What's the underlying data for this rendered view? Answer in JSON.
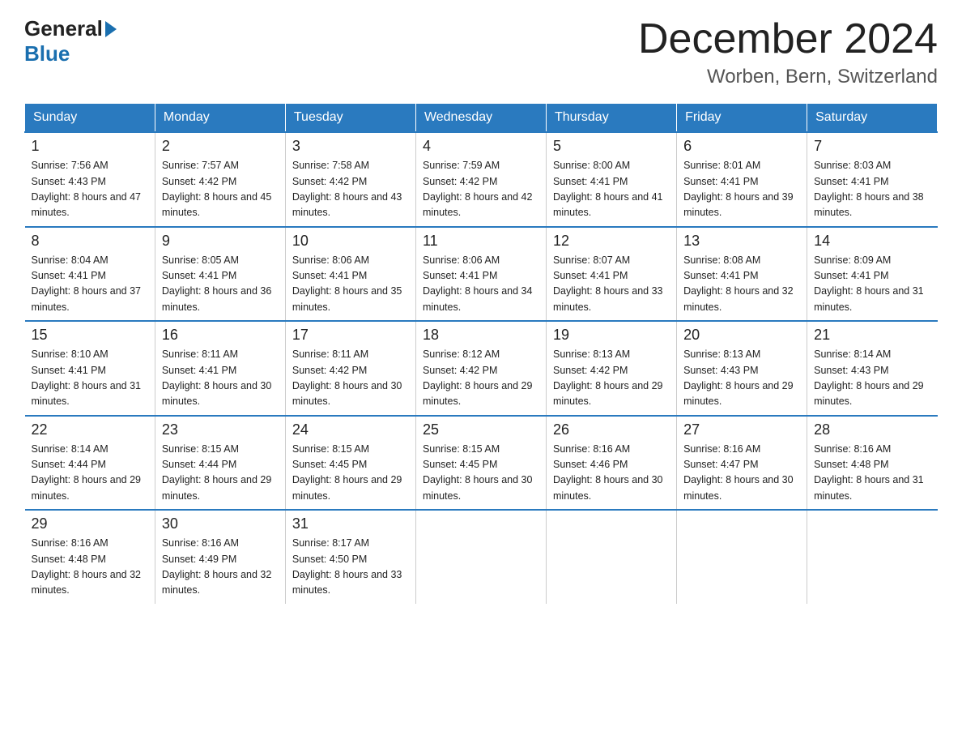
{
  "header": {
    "logo_general": "General",
    "logo_blue": "Blue",
    "month_title": "December 2024",
    "location": "Worben, Bern, Switzerland"
  },
  "days_of_week": [
    "Sunday",
    "Monday",
    "Tuesday",
    "Wednesday",
    "Thursday",
    "Friday",
    "Saturday"
  ],
  "weeks": [
    [
      {
        "day": 1,
        "sunrise": "7:56 AM",
        "sunset": "4:43 PM",
        "daylight": "8 hours and 47 minutes."
      },
      {
        "day": 2,
        "sunrise": "7:57 AM",
        "sunset": "4:42 PM",
        "daylight": "8 hours and 45 minutes."
      },
      {
        "day": 3,
        "sunrise": "7:58 AM",
        "sunset": "4:42 PM",
        "daylight": "8 hours and 43 minutes."
      },
      {
        "day": 4,
        "sunrise": "7:59 AM",
        "sunset": "4:42 PM",
        "daylight": "8 hours and 42 minutes."
      },
      {
        "day": 5,
        "sunrise": "8:00 AM",
        "sunset": "4:41 PM",
        "daylight": "8 hours and 41 minutes."
      },
      {
        "day": 6,
        "sunrise": "8:01 AM",
        "sunset": "4:41 PM",
        "daylight": "8 hours and 39 minutes."
      },
      {
        "day": 7,
        "sunrise": "8:03 AM",
        "sunset": "4:41 PM",
        "daylight": "8 hours and 38 minutes."
      }
    ],
    [
      {
        "day": 8,
        "sunrise": "8:04 AM",
        "sunset": "4:41 PM",
        "daylight": "8 hours and 37 minutes."
      },
      {
        "day": 9,
        "sunrise": "8:05 AM",
        "sunset": "4:41 PM",
        "daylight": "8 hours and 36 minutes."
      },
      {
        "day": 10,
        "sunrise": "8:06 AM",
        "sunset": "4:41 PM",
        "daylight": "8 hours and 35 minutes."
      },
      {
        "day": 11,
        "sunrise": "8:06 AM",
        "sunset": "4:41 PM",
        "daylight": "8 hours and 34 minutes."
      },
      {
        "day": 12,
        "sunrise": "8:07 AM",
        "sunset": "4:41 PM",
        "daylight": "8 hours and 33 minutes."
      },
      {
        "day": 13,
        "sunrise": "8:08 AM",
        "sunset": "4:41 PM",
        "daylight": "8 hours and 32 minutes."
      },
      {
        "day": 14,
        "sunrise": "8:09 AM",
        "sunset": "4:41 PM",
        "daylight": "8 hours and 31 minutes."
      }
    ],
    [
      {
        "day": 15,
        "sunrise": "8:10 AM",
        "sunset": "4:41 PM",
        "daylight": "8 hours and 31 minutes."
      },
      {
        "day": 16,
        "sunrise": "8:11 AM",
        "sunset": "4:41 PM",
        "daylight": "8 hours and 30 minutes."
      },
      {
        "day": 17,
        "sunrise": "8:11 AM",
        "sunset": "4:42 PM",
        "daylight": "8 hours and 30 minutes."
      },
      {
        "day": 18,
        "sunrise": "8:12 AM",
        "sunset": "4:42 PM",
        "daylight": "8 hours and 29 minutes."
      },
      {
        "day": 19,
        "sunrise": "8:13 AM",
        "sunset": "4:42 PM",
        "daylight": "8 hours and 29 minutes."
      },
      {
        "day": 20,
        "sunrise": "8:13 AM",
        "sunset": "4:43 PM",
        "daylight": "8 hours and 29 minutes."
      },
      {
        "day": 21,
        "sunrise": "8:14 AM",
        "sunset": "4:43 PM",
        "daylight": "8 hours and 29 minutes."
      }
    ],
    [
      {
        "day": 22,
        "sunrise": "8:14 AM",
        "sunset": "4:44 PM",
        "daylight": "8 hours and 29 minutes."
      },
      {
        "day": 23,
        "sunrise": "8:15 AM",
        "sunset": "4:44 PM",
        "daylight": "8 hours and 29 minutes."
      },
      {
        "day": 24,
        "sunrise": "8:15 AM",
        "sunset": "4:45 PM",
        "daylight": "8 hours and 29 minutes."
      },
      {
        "day": 25,
        "sunrise": "8:15 AM",
        "sunset": "4:45 PM",
        "daylight": "8 hours and 30 minutes."
      },
      {
        "day": 26,
        "sunrise": "8:16 AM",
        "sunset": "4:46 PM",
        "daylight": "8 hours and 30 minutes."
      },
      {
        "day": 27,
        "sunrise": "8:16 AM",
        "sunset": "4:47 PM",
        "daylight": "8 hours and 30 minutes."
      },
      {
        "day": 28,
        "sunrise": "8:16 AM",
        "sunset": "4:48 PM",
        "daylight": "8 hours and 31 minutes."
      }
    ],
    [
      {
        "day": 29,
        "sunrise": "8:16 AM",
        "sunset": "4:48 PM",
        "daylight": "8 hours and 32 minutes."
      },
      {
        "day": 30,
        "sunrise": "8:16 AM",
        "sunset": "4:49 PM",
        "daylight": "8 hours and 32 minutes."
      },
      {
        "day": 31,
        "sunrise": "8:17 AM",
        "sunset": "4:50 PM",
        "daylight": "8 hours and 33 minutes."
      },
      null,
      null,
      null,
      null
    ]
  ]
}
